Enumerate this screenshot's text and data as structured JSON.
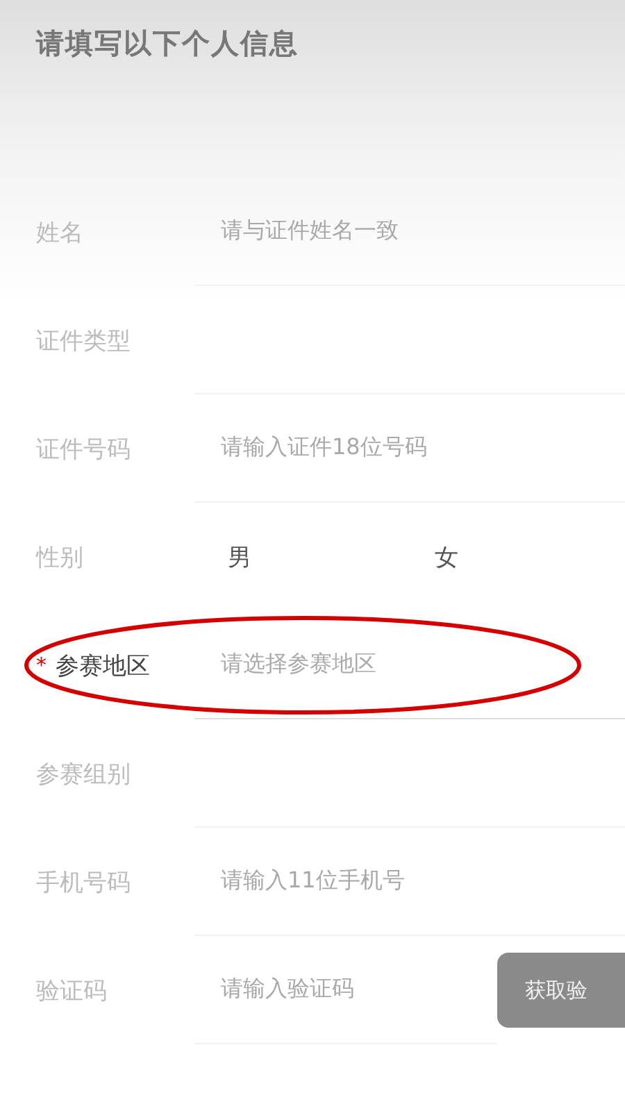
{
  "title": "请填写以下个人信息",
  "fields": [
    {
      "kind": "input",
      "label": "姓名",
      "placeholder": "请与证件姓名一致"
    },
    {
      "kind": "select",
      "label": "证件类型"
    },
    {
      "kind": "input",
      "label": "证件号码",
      "placeholder": "请输入证件18位号码"
    },
    {
      "kind": "radio",
      "label": "性别",
      "options": [
        {
          "label": "男",
          "selected": false
        },
        {
          "label": "女",
          "selected": false
        }
      ]
    },
    {
      "kind": "select",
      "label": "参赛地区",
      "placeholder": "请选择参赛地区",
      "required": true,
      "required_mark": "*",
      "highlighted": true
    },
    {
      "kind": "select",
      "label": "参赛组别"
    },
    {
      "kind": "input",
      "label": "手机号码",
      "placeholder": "请输入11位手机号"
    },
    {
      "kind": "code",
      "label": "验证码",
      "placeholder": "请输入验证码",
      "button": "获取验"
    }
  ]
}
